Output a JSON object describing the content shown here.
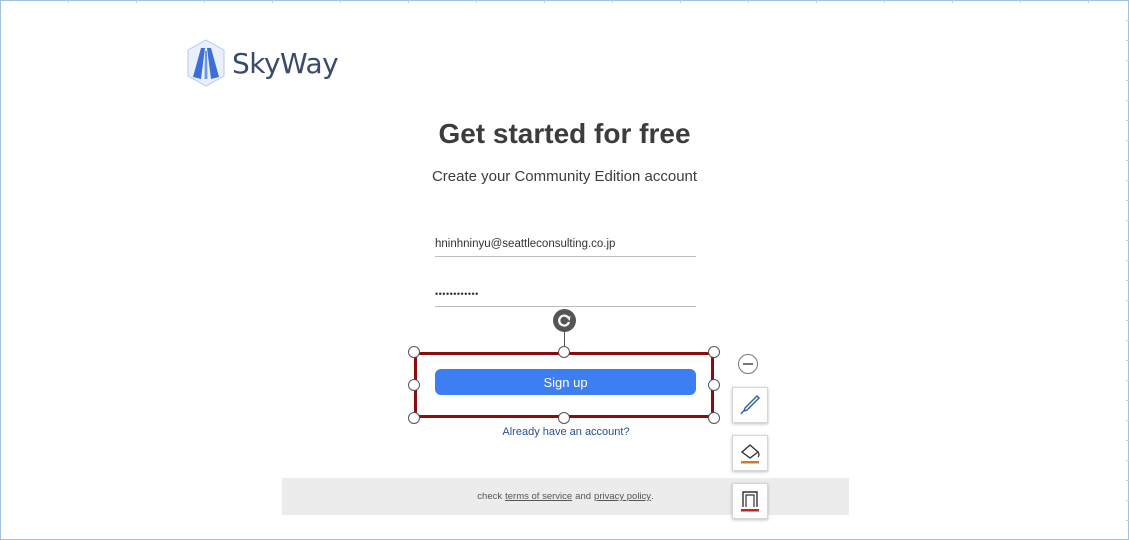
{
  "brand": {
    "name": "SkyWay"
  },
  "heading": {
    "title": "Get started for free",
    "subtitle": "Create your Community Edition account"
  },
  "form": {
    "email_value": "hninhninyu@seattleconsulting.co.jp",
    "password_value": "••••••••••••",
    "signup_label": "Sign up",
    "signin_link": "Already have an account?"
  },
  "footer": {
    "prefix": "check",
    "terms_link": "terms of service",
    "conjunction": "and",
    "privacy_link": "privacy policy",
    "suffix": "."
  },
  "colors": {
    "accent": "#3d7ef3",
    "selection": "#8b0d0d",
    "brand": "#3a4a6b"
  },
  "icons": [
    "skyway-logo-icon",
    "rotate-icon",
    "collapse-icon",
    "pen-icon",
    "fill-icon",
    "border-icon"
  ]
}
